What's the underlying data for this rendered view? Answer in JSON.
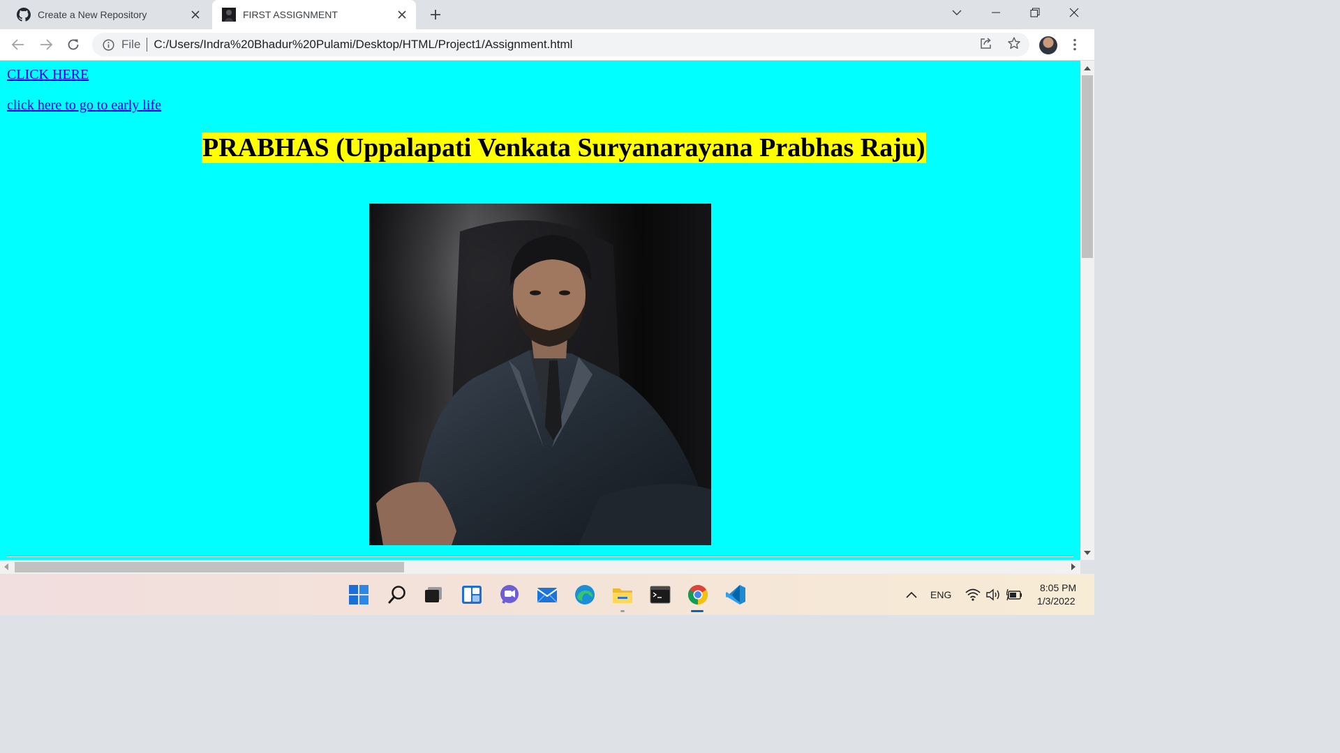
{
  "browser": {
    "tabs": [
      {
        "title": "Create a New Repository",
        "active": false,
        "icon": "github-icon"
      },
      {
        "title": "FIRST ASSIGNMENT",
        "active": true,
        "icon": "page-thumbnail-icon"
      }
    ],
    "omnibox": {
      "scheme_label": "File",
      "url": "C:/Users/Indra%20Bhadur%20Pulami/Desktop/HTML/Project1/Assignment.html"
    }
  },
  "page": {
    "background_color": "#00ffff",
    "links": [
      {
        "text": "CLICK HERE"
      },
      {
        "text": "click here to go to early life"
      }
    ],
    "heading": "PRABHAS (Uppalapati Venkata Suryanarayana Prabhas Raju)",
    "heading_highlight": "#ffff00",
    "image_subject": "portrait-photo"
  },
  "taskbar": {
    "apps": [
      "windows-start-icon",
      "search-icon",
      "task-view-icon",
      "widgets-icon",
      "teams-chat-icon",
      "mail-icon",
      "edge-icon",
      "file-explorer-icon",
      "terminal-icon",
      "chrome-icon",
      "vscode-icon"
    ],
    "tray": {
      "language": "ENG",
      "time": "8:05 PM",
      "date": "1/3/2022"
    }
  }
}
